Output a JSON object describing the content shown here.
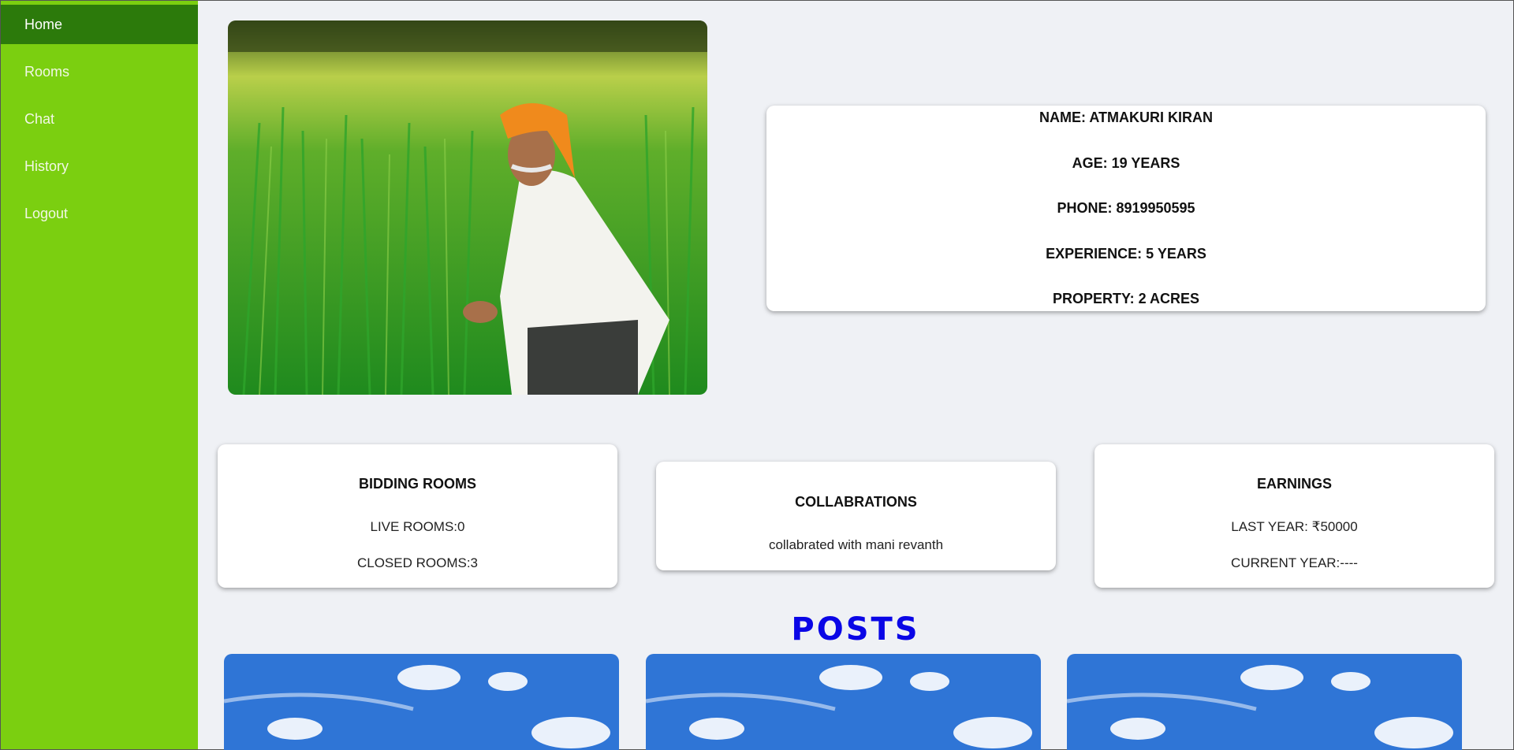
{
  "sidebar": {
    "items": [
      {
        "label": "Home",
        "active": true
      },
      {
        "label": "Rooms"
      },
      {
        "label": "Chat"
      },
      {
        "label": "History"
      },
      {
        "label": "Logout"
      }
    ]
  },
  "profile": {
    "name_line": "NAME: ATMAKURI KIRAN",
    "age_line": "AGE: 19 YEARS",
    "phone_line": "PHONE: 8919950595",
    "experience_line": "EXPERIENCE: 5 YEARS",
    "property_line": "PROPERTY: 2 ACRES"
  },
  "bidding": {
    "title": "BIDDING ROOMS",
    "live": "LIVE ROOMS:0",
    "closed": "CLOSED ROOMS:3"
  },
  "collab": {
    "title": "COLLABRATIONS",
    "text": "collabrated with mani revanth"
  },
  "earnings": {
    "title": "EARNINGS",
    "last_year": "LAST YEAR: ₹50000",
    "current_year": "CURRENT YEAR:----"
  },
  "posts": {
    "title": "POSTS"
  },
  "colors": {
    "sidebar": "#7bcf10",
    "sidebar_active": "#2c7a0b",
    "posts_title": "#0a06e6",
    "background": "#eff1f5"
  }
}
